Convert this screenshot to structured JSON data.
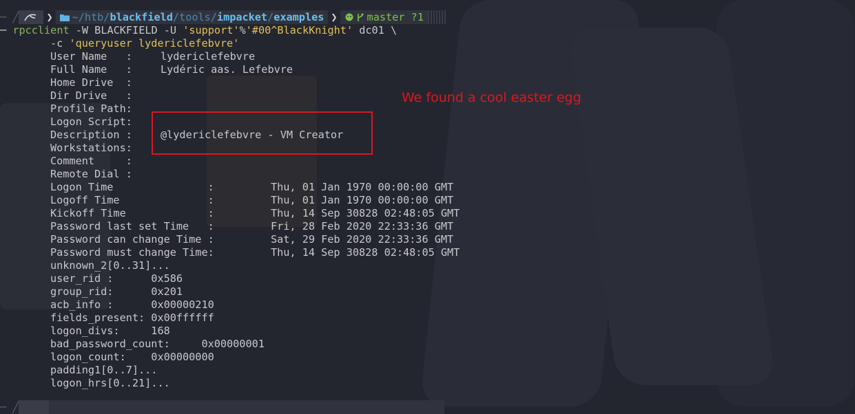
{
  "prompt": {
    "path_prefix": "~/htb/",
    "path_part1": "blackfield",
    "path_sep1": "/tools/",
    "path_part2": "impacket",
    "path_sep2": "/",
    "path_part3": "examples",
    "branch": "master ?1"
  },
  "command": {
    "dash": "─",
    "program": "rpcclient",
    "args1": " -W BLACKFIELD -U ",
    "arg_user": "'support'",
    "arg_pct": "%",
    "arg_pass": "'#00^BlackKnight'",
    "args2": " dc01 \\",
    "line2_opt": "-c ",
    "line2_query": "'queryuser lydericlefebvre'"
  },
  "output": [
    {
      "label": "User Name   :",
      "value": "lydericlefebvre"
    },
    {
      "label": "Full Name   :",
      "value": "Lydéric aas. Lefebvre"
    },
    {
      "label": "Home Drive  :",
      "value": ""
    },
    {
      "label": "Dir Drive   :",
      "value": ""
    },
    {
      "label": "Profile Path:",
      "value": ""
    },
    {
      "label": "Logon Script:",
      "value": ""
    },
    {
      "label": "Description :",
      "value": "@lydericlefebvre - VM Creator"
    },
    {
      "label": "Workstations:",
      "value": ""
    },
    {
      "label": "Comment     :",
      "value": ""
    },
    {
      "label": "Remote Dial :",
      "value": ""
    }
  ],
  "times": [
    {
      "label": "Logon Time               :",
      "value": "Thu, 01 Jan 1970 00:00:00 GMT"
    },
    {
      "label": "Logoff Time              :",
      "value": "Thu, 01 Jan 1970 00:00:00 GMT"
    },
    {
      "label": "Kickoff Time             :",
      "value": "Thu, 14 Sep 30828 02:48:05 GMT"
    },
    {
      "label": "Password last set Time   :",
      "value": "Fri, 28 Feb 2020 22:33:36 GMT"
    },
    {
      "label": "Password can change Time :",
      "value": "Sat, 29 Feb 2020 22:33:36 GMT"
    },
    {
      "label": "Password must change Time:",
      "value": "Thu, 14 Sep 30828 02:48:05 GMT"
    }
  ],
  "misc": [
    {
      "text": "unknown_2[0..31]..."
    },
    {
      "text": "user_rid :      0x586"
    },
    {
      "text": "group_rid:      0x201"
    },
    {
      "text": "acb_info :      0x00000210"
    },
    {
      "text": "fields_present: 0x00ffffff"
    },
    {
      "text": "logon_divs:     168"
    },
    {
      "text": "bad_password_count:     0x00000001"
    },
    {
      "text": "logon_count:    0x00000000"
    },
    {
      "text": "padding1[0..7]..."
    },
    {
      "text": "logon_hrs[0..21]..."
    }
  ],
  "annotation": "We found a cool easter egg",
  "colors": {
    "annotation": "#e0161c",
    "program": "#8ab55a",
    "string": "#e2c15a",
    "path": "#5fb2e4",
    "git": "#7cc24a"
  }
}
